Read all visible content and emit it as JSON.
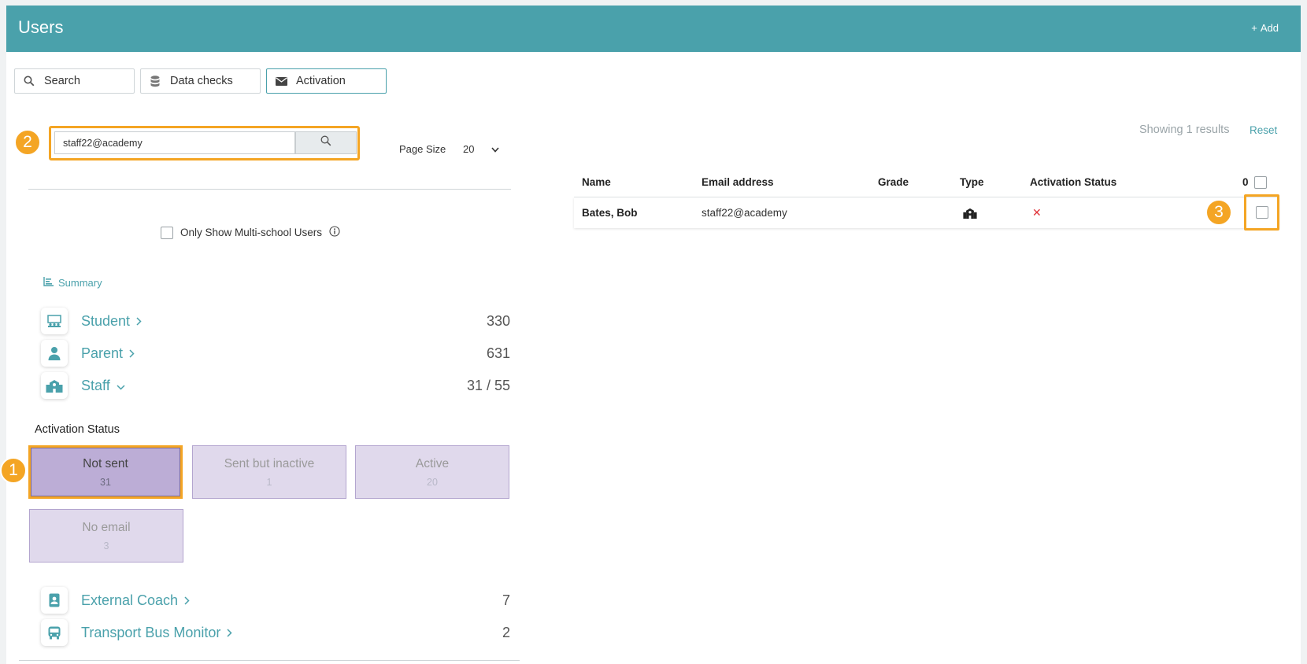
{
  "header": {
    "title": "Users",
    "add_label": "Add"
  },
  "tabs": [
    {
      "label": "Search",
      "icon": "search-icon"
    },
    {
      "label": "Data checks",
      "icon": "database-icon"
    },
    {
      "label": "Activation",
      "icon": "envelope-icon",
      "active": true
    }
  ],
  "search": {
    "value": "staff22@academy",
    "placeholder": ""
  },
  "page_size": {
    "label": "Page Size",
    "value": "20"
  },
  "multischool_label": "Only Show Multi-school Users",
  "summary_label": "Summary",
  "categories_top": [
    {
      "name": "Student",
      "count": "330",
      "icon": "classroom-icon",
      "expanded": false
    },
    {
      "name": "Parent",
      "count": "631",
      "icon": "person-icon",
      "expanded": false
    },
    {
      "name": "Staff",
      "count": "31 / 55",
      "icon": "school-building-icon",
      "expanded": true
    }
  ],
  "activation": {
    "title": "Activation Status",
    "statuses": [
      {
        "label": "Not sent",
        "count": "31",
        "selected": true
      },
      {
        "label": "Sent but inactive",
        "count": "1",
        "selected": false
      },
      {
        "label": "Active",
        "count": "20",
        "selected": false
      },
      {
        "label": "No email",
        "count": "3",
        "selected": false
      }
    ]
  },
  "categories_bottom": [
    {
      "name": "External Coach",
      "count": "7",
      "icon": "id-badge-icon"
    },
    {
      "name": "Transport Bus Monitor",
      "count": "2",
      "icon": "bus-icon"
    }
  ],
  "results": {
    "text": "Showing 1 results",
    "reset_label": "Reset"
  },
  "table": {
    "columns": [
      "Name",
      "Email address",
      "Grade",
      "Type",
      "Activation Status"
    ],
    "selected_count": "0",
    "rows": [
      {
        "name": "Bates, Bob",
        "email": "staff22@academy",
        "grade": "",
        "type_icon": "school-building-icon",
        "status": "✕"
      }
    ]
  },
  "callouts": [
    "1",
    "2",
    "3"
  ],
  "colors": {
    "header_bg": "#4aa1ab",
    "accent": "#4aa1ab",
    "highlight": "#f4a524",
    "status_fill": "#e0d9ec",
    "status_selected": "#bcadd6",
    "status_x": "#e0343a"
  }
}
